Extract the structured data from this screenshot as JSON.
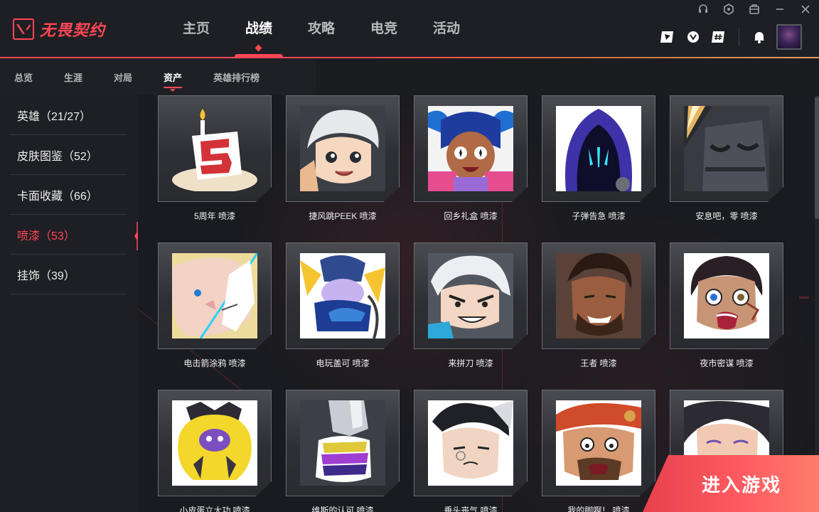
{
  "app": {
    "logo_text": "无畏契约"
  },
  "main_nav": [
    {
      "label": "主页",
      "active": false
    },
    {
      "label": "战绩",
      "active": true
    },
    {
      "label": "攻略",
      "active": false
    },
    {
      "label": "电竞",
      "active": false
    },
    {
      "label": "活动",
      "active": false
    }
  ],
  "sub_nav": [
    {
      "label": "总览",
      "active": false
    },
    {
      "label": "生涯",
      "active": false
    },
    {
      "label": "对局",
      "active": false
    },
    {
      "label": "资产",
      "active": true
    },
    {
      "label": "英雄排行榜",
      "active": false
    }
  ],
  "sidebar": [
    {
      "label": "英雄（21/27）",
      "active": false
    },
    {
      "label": "皮肤图鉴（52）",
      "active": false
    },
    {
      "label": "卡面收藏（66）",
      "active": false
    },
    {
      "label": "喷漆（53）",
      "active": true
    },
    {
      "label": "挂饰（39）",
      "active": false
    }
  ],
  "sprays": [
    {
      "label": "5周年 喷漆",
      "icon": "birthday-cake-5-icon"
    },
    {
      "label": "捷风跳PEEK 喷漆",
      "icon": "jett-peek-icon"
    },
    {
      "label": "回乡礼盒 喷漆",
      "icon": "gift-box-icon"
    },
    {
      "label": "子弹告急 喷漆",
      "icon": "hooded-omen-icon"
    },
    {
      "label": "安息吧，零 喷漆",
      "icon": "robot-helmet-icon"
    },
    {
      "label": "电击箭涂鸦 喷漆",
      "icon": "shock-arrow-icon"
    },
    {
      "label": "电玩盖可 喷漆",
      "icon": "gamer-gekko-icon"
    },
    {
      "label": "来拼刀 喷漆",
      "icon": "knife-fight-icon"
    },
    {
      "label": "王者 喷漆",
      "icon": "king-portrait-icon"
    },
    {
      "label": "夜市密谋 喷漆",
      "icon": "night-market-icon"
    },
    {
      "label": "小皮蛋立大功 喷漆",
      "icon": "yellow-creature-icon"
    },
    {
      "label": "维斯的认可 喷漆",
      "icon": "thumbs-up-icon"
    },
    {
      "label": "垂头丧气 喷漆",
      "icon": "sad-yoru-icon"
    },
    {
      "label": "我的脚啊！ 喷漆",
      "icon": "crying-face-icon"
    },
    {
      "label": "",
      "icon": "smiling-woman-icon"
    }
  ],
  "play_button": {
    "label": "进入游戏"
  }
}
